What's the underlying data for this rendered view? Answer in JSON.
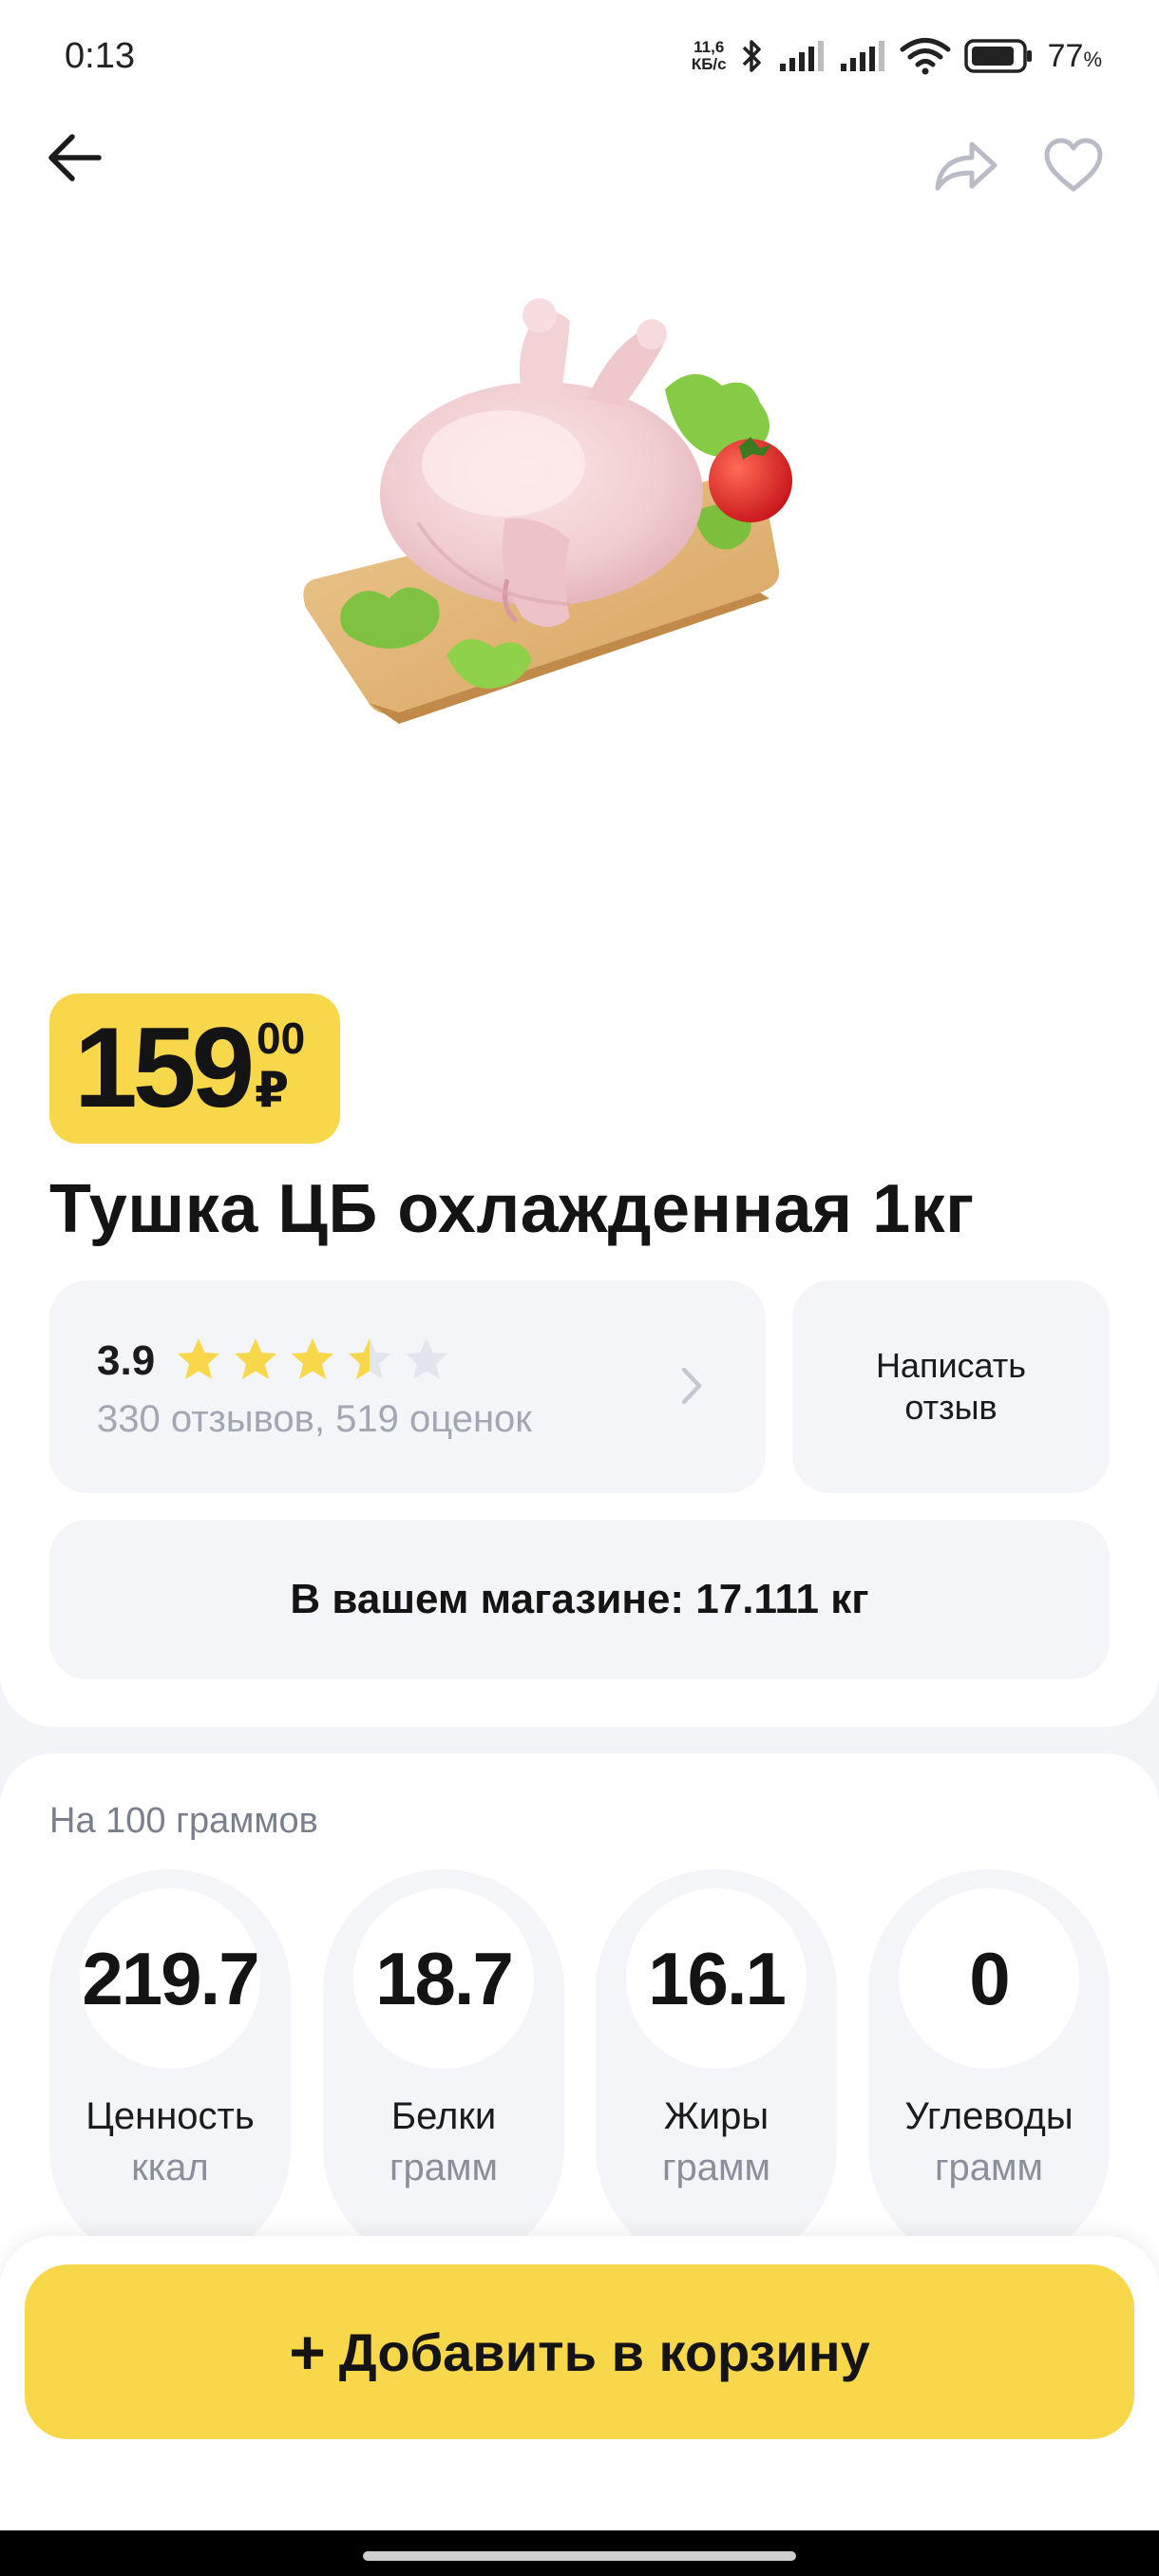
{
  "status_bar": {
    "time": "0:13",
    "net_speed_value": "11,6",
    "net_speed_unit": "КБ/с",
    "battery_percent": "77",
    "battery_percent_sign": "%"
  },
  "header": {
    "back_icon": "arrow-left-icon",
    "share_icon": "share-icon",
    "favorite_icon": "heart-outline-icon"
  },
  "product": {
    "image_description_icon": "chicken-on-board-image",
    "price_integer": "159",
    "price_fraction": "00",
    "currency": "₽",
    "title": "Тушка ЦБ охлажденная 1кг"
  },
  "rating": {
    "value": "3.9",
    "stars_out_of_5": 3.5,
    "reviews_text": "330 отзывов, 519 оценок",
    "star_color": "#f8d84a",
    "star_empty_color": "#e3e5ec"
  },
  "write_review": {
    "label": "Написать отзыв"
  },
  "store": {
    "availability_text": "В вашем магазине: 17.111 кг"
  },
  "nutrition": {
    "caption": "На 100 граммов",
    "items": [
      {
        "value": "219.7",
        "label": "Ценность",
        "unit": "ккал"
      },
      {
        "value": "18.7",
        "label": "Белки",
        "unit": "грамм"
      },
      {
        "value": "16.1",
        "label": "Жиры",
        "unit": "грамм"
      },
      {
        "value": "0",
        "label": "Углеводы",
        "unit": "грамм"
      }
    ]
  },
  "cart": {
    "plus": "+",
    "add_label": "Добавить в корзину",
    "accent_color": "#f8d84a"
  }
}
